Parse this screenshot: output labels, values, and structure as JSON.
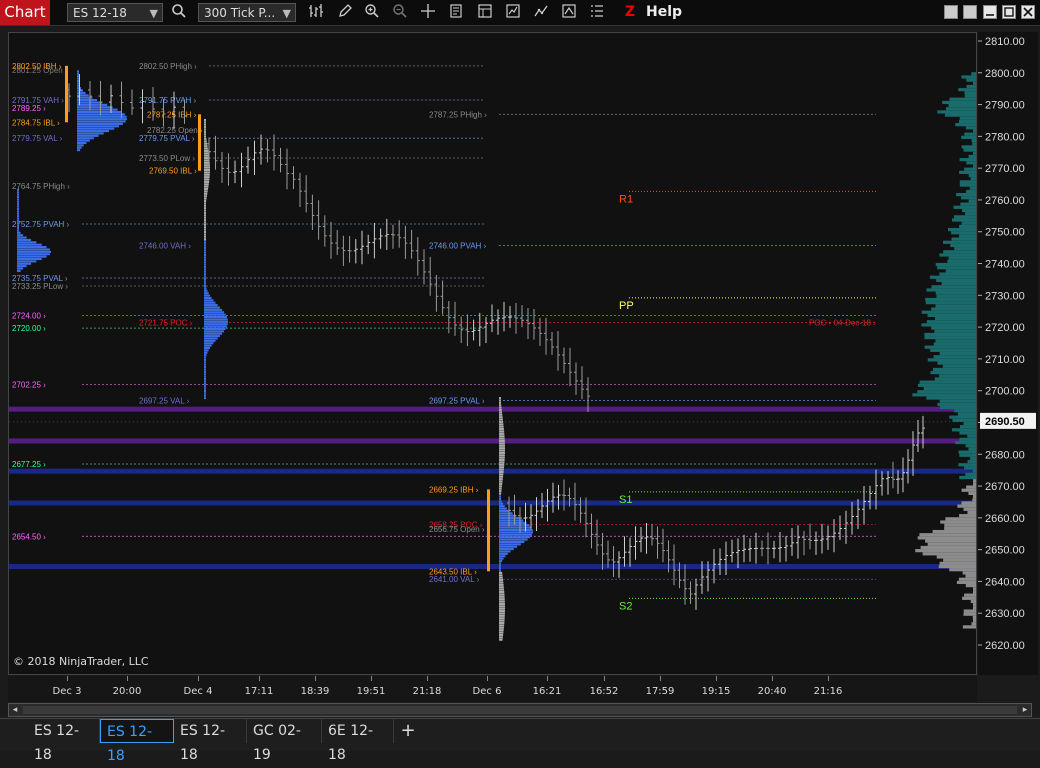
{
  "toolbar": {
    "chart_label": "Chart",
    "instrument": "ES 12-18",
    "interval": "300 Tick P...",
    "help_label": "Help",
    "icons": [
      "search-icon",
      "bar-chart-icon",
      "pencil-icon",
      "zoom-in-icon",
      "zoom-out-icon",
      "crosshair-icon",
      "properties-icon",
      "data-box-icon",
      "indicators-icon",
      "strategies-icon",
      "chart-trader-icon",
      "dom-icon",
      "z-icon"
    ]
  },
  "window_buttons": [
    "minimize-icon",
    "restore-icon",
    "maximize-icon",
    "close-icon"
  ],
  "colors": {
    "background": "#111111",
    "up_bar": "#dcdcdc",
    "profile_blue": "#3b6ee8",
    "profile_gray": "#b5b5b5",
    "vp_teal": "#1a6b6b",
    "purple_band": "#5a1e8a",
    "navy_band": "#1a2a8a",
    "r1": "#ff4d1a",
    "pp": "#ffff66",
    "s1s2": "#66ee44"
  },
  "chart": {
    "copyright": "© 2018 NinjaTrader, LLC",
    "y_ticks": [
      "2810.00",
      "2800.00",
      "2790.00",
      "2780.00",
      "2770.00",
      "2760.00",
      "2750.00",
      "2740.00",
      "2730.00",
      "2720.00",
      "2710.00",
      "2700.00",
      "2690.00",
      "2680.00",
      "2670.00",
      "2660.00",
      "2650.00",
      "2640.00",
      "2630.00",
      "2620.00"
    ],
    "y_range": [
      2616,
      2812
    ],
    "last_price": "2690.50",
    "x_ticks": [
      "Dec 3",
      "20:00",
      "Dec 4",
      "17:11",
      "18:39",
      "19:51",
      "21:18",
      "Dec 6",
      "16:21",
      "16:52",
      "17:59",
      "19:15",
      "20:40",
      "21:16"
    ],
    "pivots": [
      {
        "label": "R1",
        "price": 2763,
        "color": "#ff4d1a"
      },
      {
        "label": "PP",
        "price": 2729.5,
        "color": "#ffff66"
      },
      {
        "label": "S1",
        "price": 2668.5,
        "color": "#66ee44"
      },
      {
        "label": "S2",
        "price": 2635,
        "color": "#66ee44"
      }
    ],
    "bands": [
      {
        "price": 2694.5,
        "color": "#5a1e8a"
      },
      {
        "price": 2684.5,
        "color": "#5a1e8a"
      },
      {
        "price": 2675,
        "color": "#1a2a8a"
      },
      {
        "price": 2665,
        "color": "#1a2a8a"
      },
      {
        "price": 2645,
        "color": "#1a2a8a"
      }
    ],
    "level_labels": [
      {
        "text": "2802.50 IBH",
        "price": 2802.5,
        "color": "#ff9d1a"
      },
      {
        "text": "2801.25 Open",
        "price": 2801.25,
        "color": "#7a7a7a"
      },
      {
        "text": "2791.75 VAH",
        "price": 2791.75,
        "color": "#7070d0"
      },
      {
        "text": "2789.25",
        "price": 2789.25,
        "color": "#ff66ff"
      },
      {
        "text": "2784.75 IBL",
        "price": 2784.75,
        "color": "#ff9d1a"
      },
      {
        "text": "2779.75 VAL",
        "price": 2779.75,
        "color": "#7070d0"
      },
      {
        "text": "2802.50 PHigh",
        "price": 2802.5,
        "color": "#8a8a8a"
      },
      {
        "text": "2791.75 PVAH",
        "price": 2791.75,
        "color": "#6a9aee"
      },
      {
        "text": "2787.25 IBH",
        "price": 2787.25,
        "color": "#ff9d1a"
      },
      {
        "text": "2782.25 Open",
        "price": 2782.25,
        "color": "#8a8a8a"
      },
      {
        "text": "2779.75 PVAL",
        "price": 2779.75,
        "color": "#6a9aee"
      },
      {
        "text": "2773.50 PLow",
        "price": 2773.5,
        "color": "#8a8a8a"
      },
      {
        "text": "2769.50 IBL",
        "price": 2769.5,
        "color": "#ff9d1a"
      },
      {
        "text": "2787.25 PHigh",
        "price": 2787.25,
        "color": "#8a8a8a"
      },
      {
        "text": "2764.75 PHigh",
        "price": 2764.75,
        "color": "#8a8a8a"
      },
      {
        "text": "2752.75 PVAH",
        "price": 2752.75,
        "color": "#6a9aee"
      },
      {
        "text": "2746.00 VAH",
        "price": 2746,
        "color": "#7070d0"
      },
      {
        "text": "2746.00 PVAH",
        "price": 2746,
        "color": "#6a9aee"
      },
      {
        "text": "2735.75 PVAL",
        "price": 2735.75,
        "color": "#6a9aee"
      },
      {
        "text": "2733.25 PLow",
        "price": 2733.25,
        "color": "#8a8a8a"
      },
      {
        "text": "2724.00",
        "price": 2724,
        "color": "#ff66ff"
      },
      {
        "text": "2720.00",
        "price": 2720,
        "color": "#33ff99"
      },
      {
        "text": "2721.75 POC",
        "price": 2721.75,
        "color": "#dd2222"
      },
      {
        "text": "POC • 04-Dec-18",
        "price": 2721.75,
        "color": "#dd2222"
      },
      {
        "text": "2702.25",
        "price": 2702.25,
        "color": "#ff66ff"
      },
      {
        "text": "2697.25 VAL",
        "price": 2697.25,
        "color": "#7070d0"
      },
      {
        "text": "2697.25 PVAL",
        "price": 2697.25,
        "color": "#6a9aee"
      },
      {
        "text": "2677.25",
        "price": 2677.25,
        "color": "#33ff99"
      },
      {
        "text": "2669.25 IBH",
        "price": 2669.25,
        "color": "#ff9d1a"
      },
      {
        "text": "2658.25 POC",
        "price": 2658.25,
        "color": "#dd2222"
      },
      {
        "text": "2656.75 Open",
        "price": 2656.75,
        "color": "#8a8a8a"
      },
      {
        "text": "2654.50",
        "price": 2654.5,
        "color": "#ff66ff"
      },
      {
        "text": "2643.50 IBL",
        "price": 2643.5,
        "color": "#ff9d1a"
      },
      {
        "text": "2641.00 VAL",
        "price": 2641,
        "color": "#7070d0"
      }
    ]
  },
  "scrollbar": {
    "left_arrow": "◂",
    "right_arrow": "▸"
  },
  "tabs": [
    {
      "label": "ES 12-18",
      "active": false
    },
    {
      "label": "ES 12-18",
      "active": true
    },
    {
      "label": "ES 12-18",
      "active": false
    },
    {
      "label": "GC 02-19",
      "active": false
    },
    {
      "label": "6E 12-18",
      "active": false
    }
  ],
  "tab_add_label": "+"
}
